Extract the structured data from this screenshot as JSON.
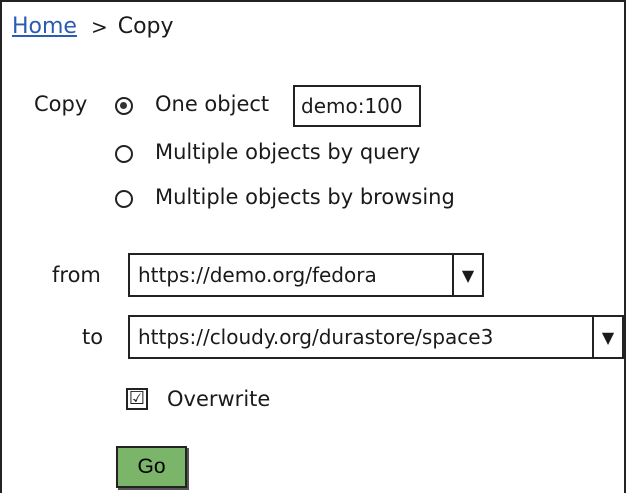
{
  "breadcrumb": {
    "home": "Home",
    "separator": ">",
    "current": "Copy"
  },
  "copy_section": {
    "label": "Copy",
    "options": [
      {
        "label": "One object",
        "checked": true
      },
      {
        "label": "Multiple objects by query",
        "checked": false
      },
      {
        "label": "Multiple objects by browsing",
        "checked": false
      }
    ],
    "object_id": "demo:100"
  },
  "from": {
    "label": "from",
    "value": "https://demo.org/fedora",
    "arrow": "▼"
  },
  "to": {
    "label": "to",
    "value": "https://cloudy.org/durastore/space3",
    "arrow": "▼"
  },
  "overwrite": {
    "label": "Overwrite",
    "checked": true,
    "mark": "☑"
  },
  "go_button": {
    "label": "Go",
    "color": "#7ab56a"
  }
}
